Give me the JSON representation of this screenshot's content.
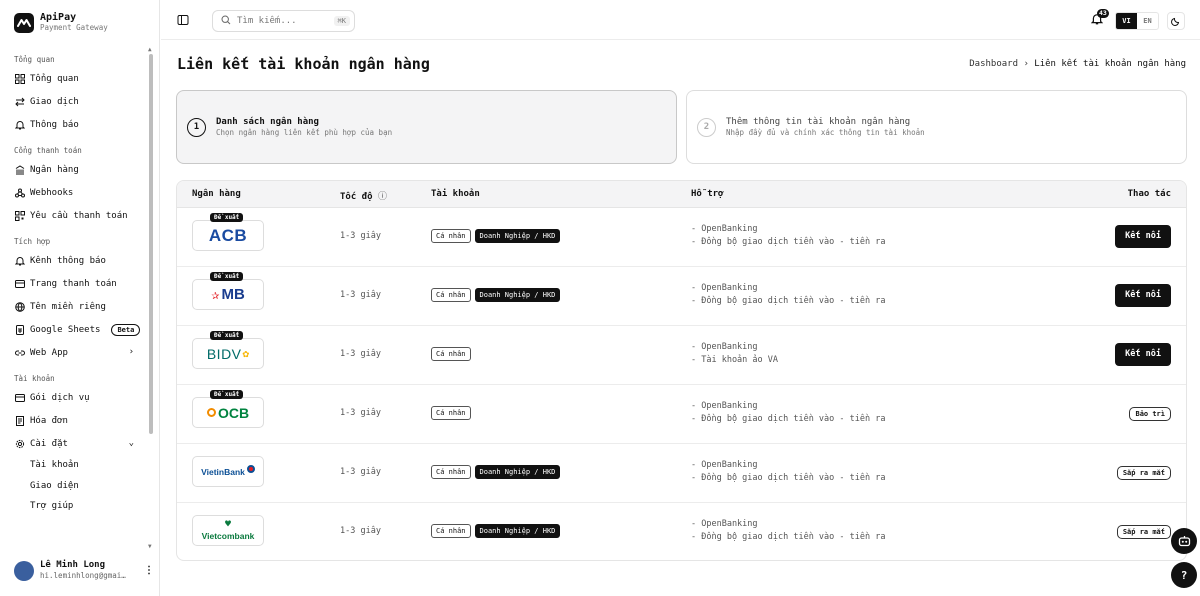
{
  "app": {
    "name": "ApiPay",
    "subtitle": "Payment Gateway"
  },
  "sidebar": {
    "sections": [
      {
        "title": "Tổng quan",
        "items": [
          "Tổng quan",
          "Giao dịch",
          "Thông báo"
        ]
      },
      {
        "title": "Cổng thanh toán",
        "items": [
          "Ngân hàng",
          "Webhooks",
          "Yêu cầu thanh toán"
        ]
      },
      {
        "title": "Tích hợp",
        "items": [
          "Kênh thông báo",
          "Trang thanh toán",
          "Tên miền riêng",
          "Google Sheets",
          "Web App"
        ]
      },
      {
        "title": "Tài khoản",
        "items": [
          "Gói dịch vụ",
          "Hóa đơn",
          "Cài đặt"
        ]
      }
    ],
    "beta": "Beta",
    "settings_sub": [
      "Tài khoản",
      "Giao diện",
      "Trợ giúp"
    ],
    "user": {
      "name": "Lê Minh Long",
      "email": "hi.leminhlong@gmai…"
    }
  },
  "topbar": {
    "search_placeholder": "Tìm kiếm...",
    "search_shortcut": "⌘K",
    "notif_count": "43",
    "lang_active": "VI",
    "lang_other": "EN"
  },
  "page": {
    "title": "Liên kết tài khoản ngân hàng",
    "breadcrumb_root": "Dashboard",
    "breadcrumb_sep": "›",
    "breadcrumb_current": "Liên kết tài khoản ngân hàng"
  },
  "steps": [
    {
      "num": "1",
      "title": "Danh sách ngân hàng",
      "desc": "Chọn ngân hàng liên kết phù hợp của bạn"
    },
    {
      "num": "2",
      "title": "Thêm thông tin tài khoản ngân hàng",
      "desc": "Nhập đầy đủ và chính xác thông tin tài khoản"
    }
  ],
  "table": {
    "headers": {
      "bank": "Ngân hàng",
      "speed": "Tốc độ",
      "account": "Tài khoản",
      "support": "Hỗ trợ",
      "action": "Thao tác"
    },
    "recommended_label": "Đề xuất",
    "rows": [
      {
        "bank": "ACB",
        "recommended": true,
        "speed": "1-3 giây",
        "tags": [
          "Cá nhân",
          "Doanh Nghiệp / HKD"
        ],
        "support": [
          "- OpenBanking",
          "- Đồng bộ giao dịch tiền vào - tiền ra"
        ],
        "action": "Kết nối",
        "action_type": "button"
      },
      {
        "bank": "MB",
        "recommended": true,
        "speed": "1-3 giây",
        "tags": [
          "Cá nhân",
          "Doanh Nghiệp / HKD"
        ],
        "support": [
          "- OpenBanking",
          "- Đồng bộ giao dịch tiền vào - tiền ra"
        ],
        "action": "Kết nối",
        "action_type": "button"
      },
      {
        "bank": "BIDV",
        "recommended": true,
        "speed": "1-3 giây",
        "tags": [
          "Cá nhân"
        ],
        "support": [
          "- OpenBanking",
          "- Tài khoản ảo VA"
        ],
        "action": "Kết nối",
        "action_type": "button"
      },
      {
        "bank": "OCB",
        "recommended": true,
        "speed": "1-3 giây",
        "tags": [
          "Cá nhân"
        ],
        "support": [
          "- OpenBanking",
          "- Đồng bộ giao dịch tiền vào - tiền ra"
        ],
        "action": "Bảo trì",
        "action_type": "pill"
      },
      {
        "bank": "VietinBank",
        "recommended": false,
        "speed": "1-3 giây",
        "tags": [
          "Cá nhân",
          "Doanh Nghiệp / HKD"
        ],
        "support": [
          "- OpenBanking",
          "- Đồng bộ giao dịch tiền vào - tiền ra"
        ],
        "action": "Sắp ra mắt",
        "action_type": "pill"
      },
      {
        "bank": "Vietcombank",
        "recommended": false,
        "speed": "1-3 giây",
        "tags": [
          "Cá nhân",
          "Doanh Nghiệp / HKD"
        ],
        "support": [
          "- OpenBanking",
          "- Đồng bộ giao dịch tiền vào - tiền ra"
        ],
        "action": "Sắp ra mắt",
        "action_type": "pill"
      }
    ]
  },
  "fab": {
    "help": "?"
  },
  "colors": {
    "primary": "#111111",
    "muted": "#777777",
    "acb": "#1a4ba1",
    "mb": "#1a3d8f",
    "mb_star": "#e31e24",
    "bidv": "#006b68",
    "bidv_accent": "#f7b500",
    "ocb": "#00833f",
    "ocb_accent": "#f28c00",
    "vietinbank": "#0b4f95",
    "vietcombank": "#0a7a3e"
  }
}
